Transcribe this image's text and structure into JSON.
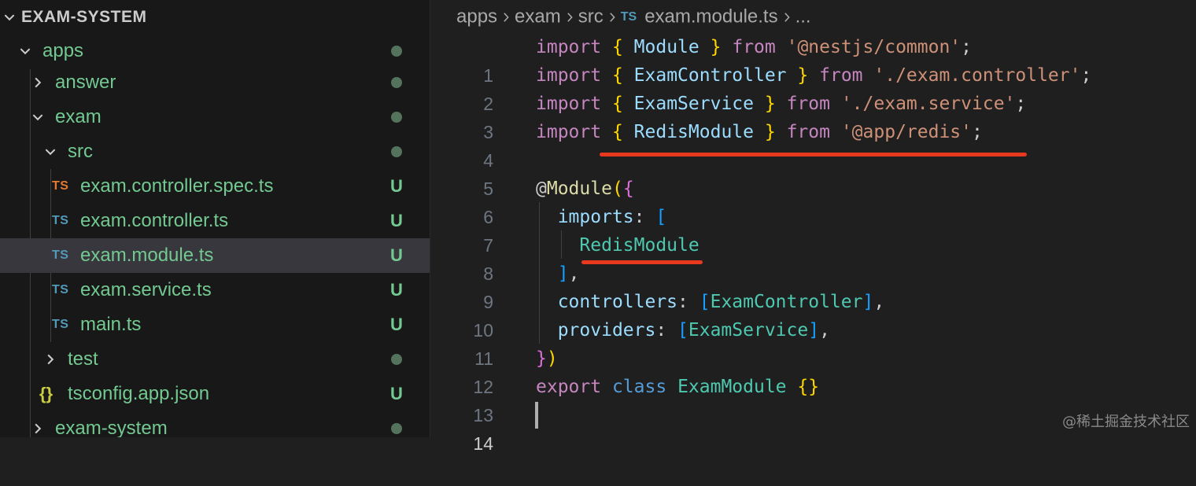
{
  "explorer": {
    "root": "EXAM-SYSTEM",
    "items": [
      {
        "label": "apps",
        "status": "dot"
      },
      {
        "label": "answer",
        "status": "dot"
      },
      {
        "label": "exam",
        "status": "dot"
      },
      {
        "label": "src",
        "status": "dot"
      },
      {
        "label": "exam.controller.spec.ts",
        "icon_text": "TS",
        "status": "U"
      },
      {
        "label": "exam.controller.ts",
        "icon_text": "TS",
        "status": "U"
      },
      {
        "label": "exam.module.ts",
        "icon_text": "TS",
        "status": "U",
        "selected": true
      },
      {
        "label": "exam.service.ts",
        "icon_text": "TS",
        "status": "U"
      },
      {
        "label": "main.ts",
        "icon_text": "TS",
        "status": "U"
      },
      {
        "label": "test",
        "status": "dot"
      },
      {
        "label": "tsconfig.app.json",
        "icon_text": "{}",
        "status": "U"
      },
      {
        "label": "exam-system",
        "status": "dot"
      }
    ]
  },
  "breadcrumb": {
    "parts": [
      "apps",
      "exam",
      "src"
    ],
    "file_icon": "TS",
    "file": "exam.module.ts",
    "ellipsis": "..."
  },
  "editor": {
    "line_numbers": [
      "1",
      "2",
      "3",
      "4",
      "5",
      "6",
      "7",
      "8",
      "9",
      "10",
      "11",
      "12",
      "13",
      "14"
    ],
    "active_line": "14"
  },
  "watermark": "@稀土掘金技术社区",
  "colors": {
    "git_untracked": "#73c991",
    "ts_icon": "#519aba",
    "spec_icon": "#e37933",
    "annotation_underline": "#e8391f"
  }
}
